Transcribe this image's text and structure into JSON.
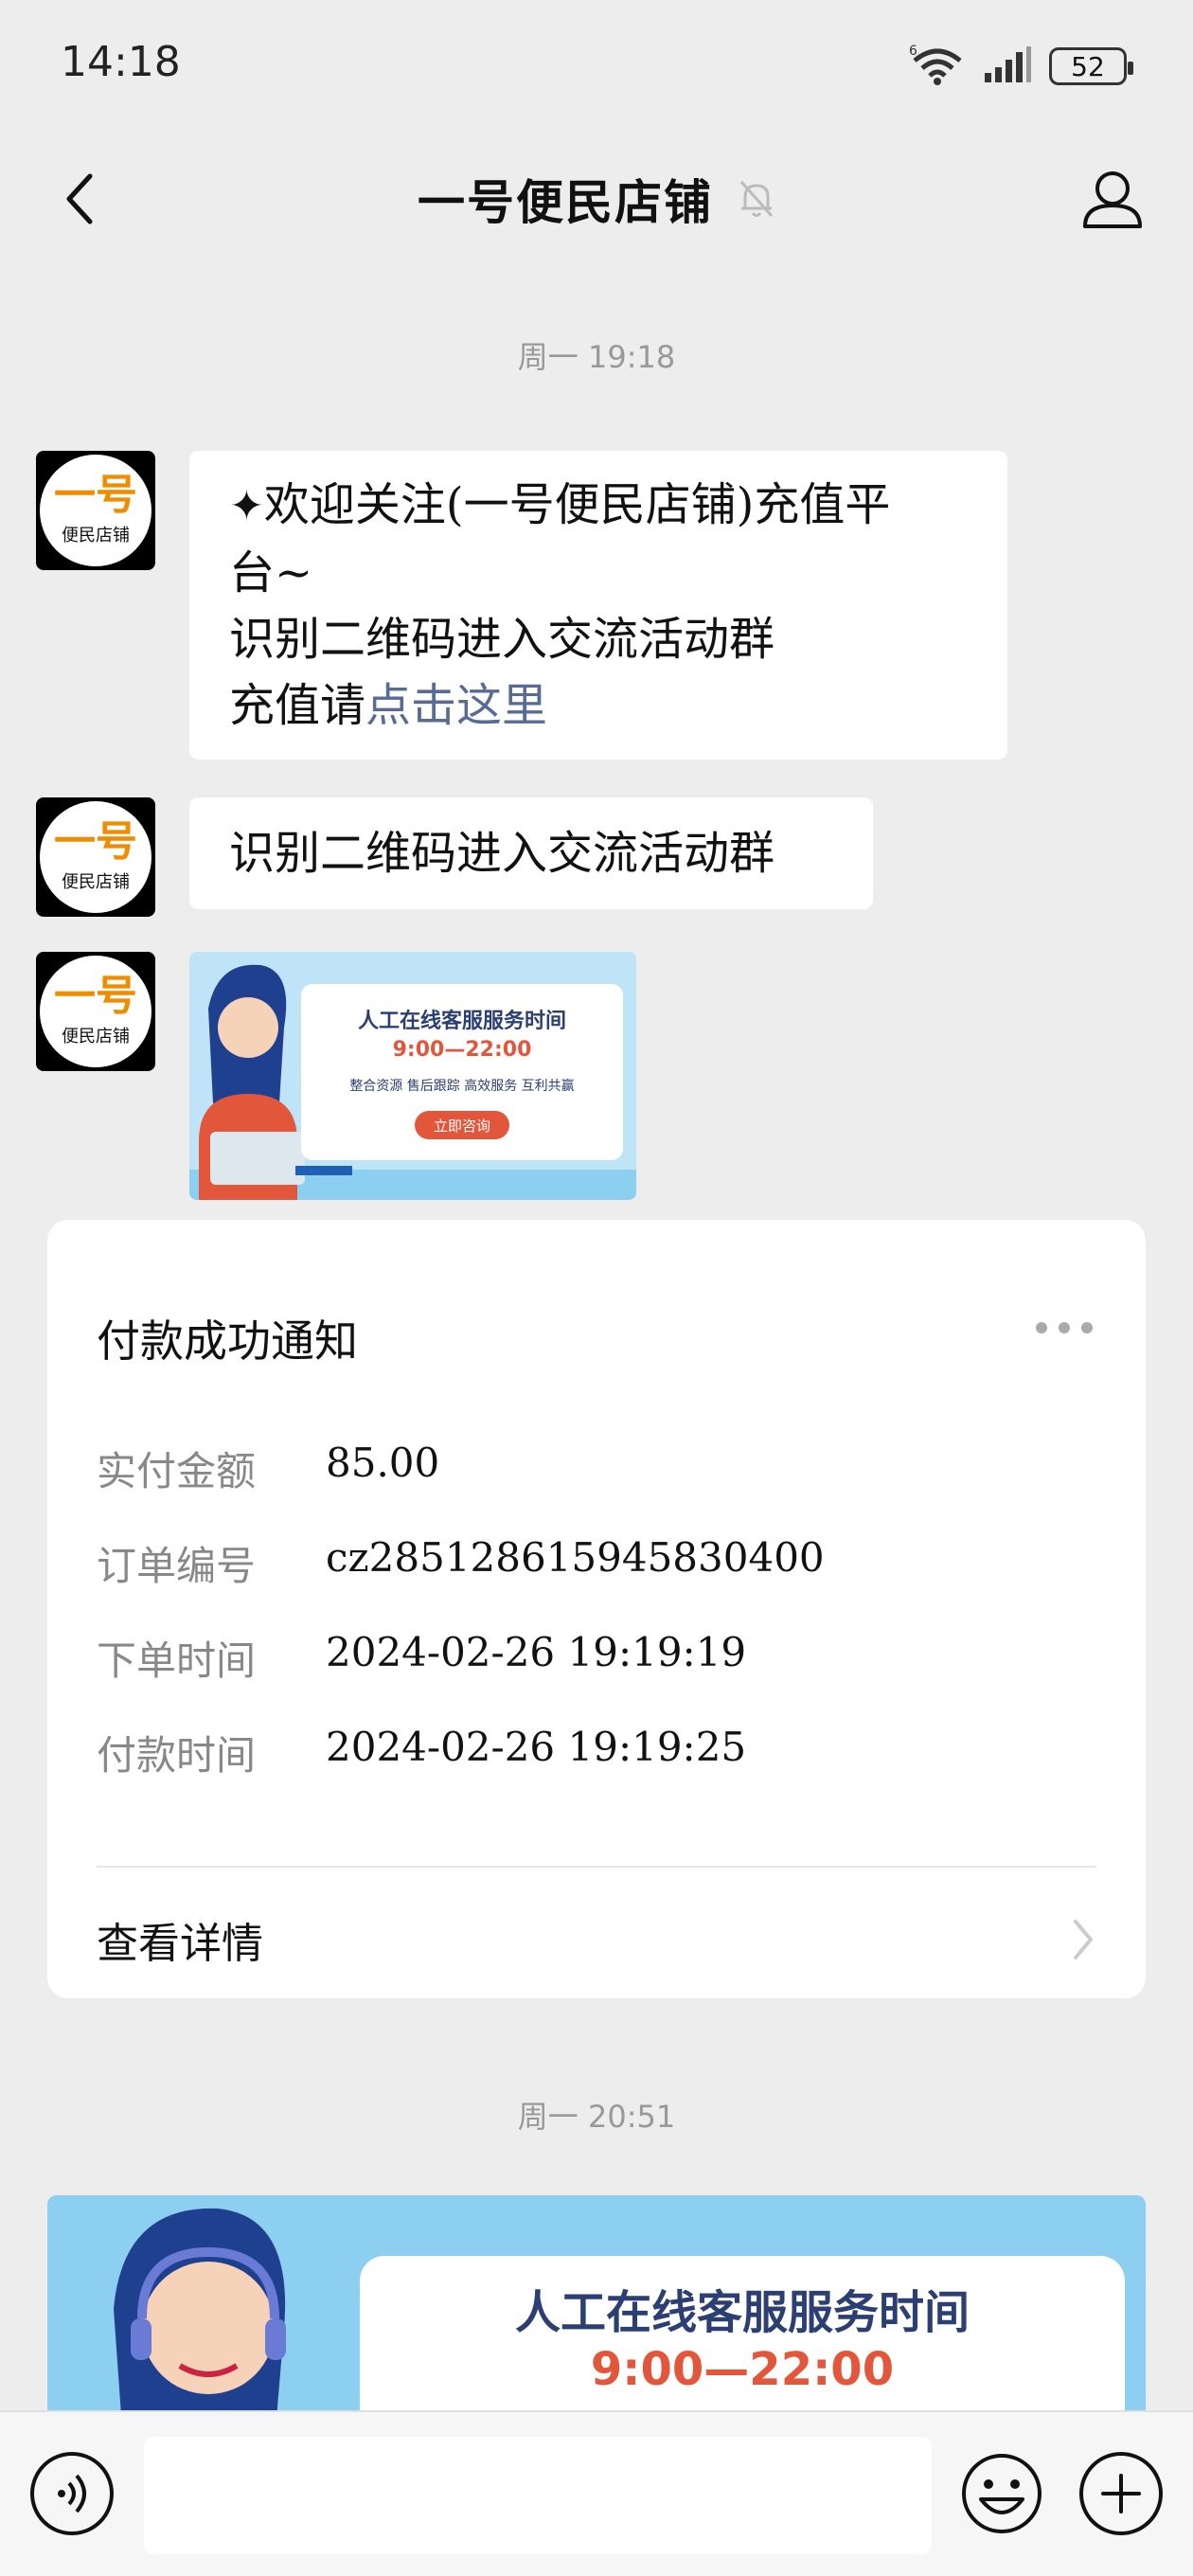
{
  "status_bar": {
    "time": "14:18",
    "battery": "52",
    "network_label": "6"
  },
  "nav": {
    "title": "一号便民店铺"
  },
  "avatar": {
    "big": "一号",
    "small": "便民店铺"
  },
  "timestamps": [
    "周一 19:18",
    "周一 20:51"
  ],
  "messages": {
    "welcome": {
      "sparkle": "✦",
      "line1": "欢迎关注(一号便民店铺)充值平",
      "line2": "台~",
      "line3": "识别二维码进入交流活动群",
      "line4_prefix": "充值请",
      "line4_link": "点击这里"
    },
    "group_text": "识别二维码进入交流活动群",
    "small_banner": {
      "title": "人工在线客服服务时间",
      "hours": "9:00—22:00",
      "tags": "整合资源  售后跟踪  高效服务  互利共赢",
      "button": "立即咨询"
    }
  },
  "payment_card": {
    "title": "付款成功通知",
    "rows": [
      {
        "label": "实付金额",
        "value": "85.00"
      },
      {
        "label": "订单编号",
        "value": "cz2851286159458304​00"
      },
      {
        "label": "下单时间",
        "value": "2024-02-26 19:19:19"
      },
      {
        "label": "付款时间",
        "value": "2024-02-26 19:19:25"
      }
    ],
    "detail_label": "查看详情"
  },
  "big_banner": {
    "title": "人工在线客服服务时间",
    "hours": "9:00—22:00"
  },
  "input_bar": {
    "placeholder": ""
  }
}
